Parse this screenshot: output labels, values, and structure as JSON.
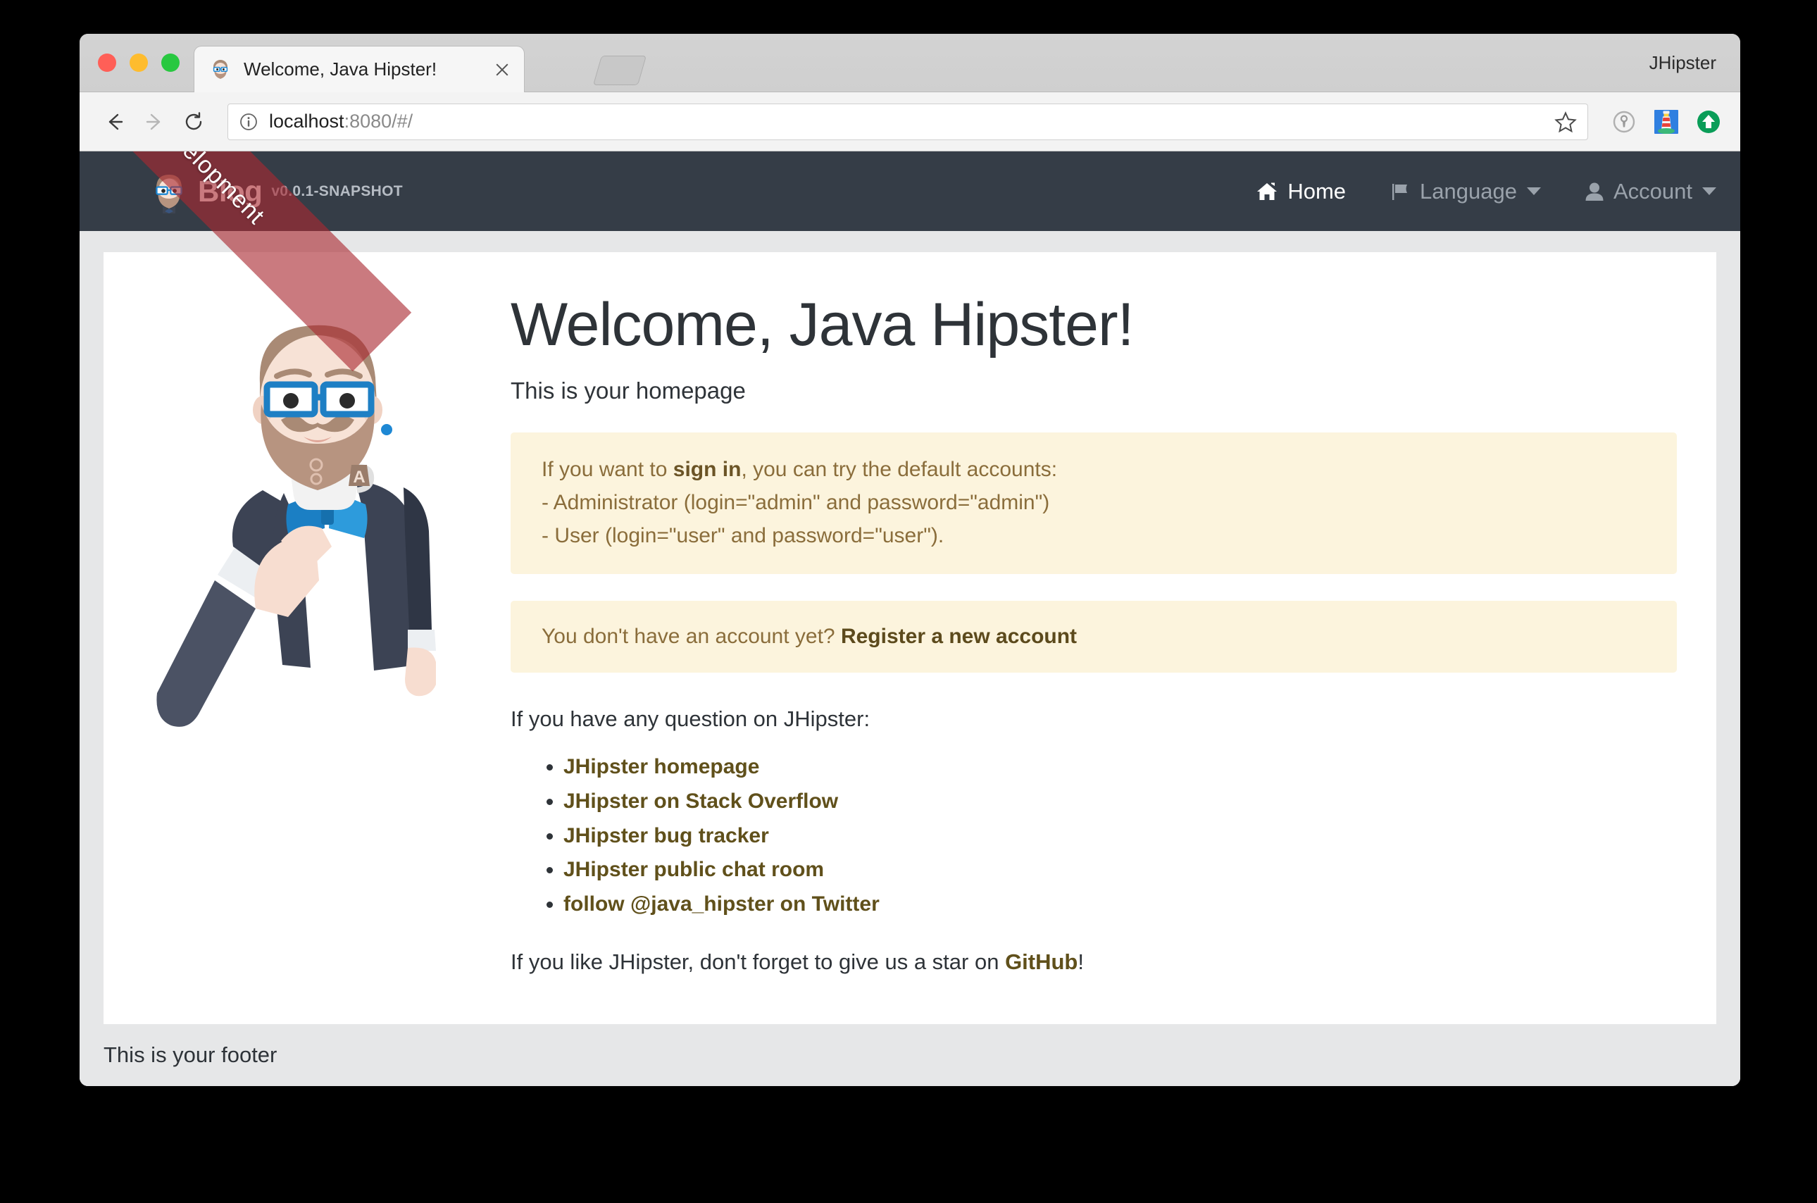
{
  "browser": {
    "profile_name": "JHipster",
    "tab": {
      "title": "Welcome, Java Hipster!",
      "favicon": "hipster-face-icon",
      "close_icon": "close-icon"
    },
    "new_tab_icon": "new-tab-icon",
    "toolbar": {
      "back_icon": "back-arrow-icon",
      "forward_icon": "forward-arrow-icon",
      "reload_icon": "reload-icon",
      "info_icon": "info-circle-icon",
      "url_host": "localhost",
      "url_rest": ":8080/#/",
      "url_full": "localhost:8080/#/",
      "bookmark_icon": "star-icon",
      "extensions": [
        {
          "name": "keyhole-icon"
        },
        {
          "name": "lighthouse-icon"
        },
        {
          "name": "green-up-arrow-icon"
        }
      ]
    },
    "traffic_lights": [
      {
        "name": "close-window-button",
        "color": "#ff5f57"
      },
      {
        "name": "minimize-window-button",
        "color": "#febc2e"
      },
      {
        "name": "maximize-window-button",
        "color": "#28c840"
      }
    ]
  },
  "app": {
    "ribbon": {
      "label": "Development",
      "color": "#aa2830"
    },
    "navbar": {
      "brand_logo": "hipster-avatar-icon",
      "brand_title": "Blog",
      "version": "v0.0.1-SNAPSHOT",
      "background": "#353d47",
      "items": [
        {
          "label": "Home",
          "icon": "home-icon",
          "active": true,
          "has_caret": false
        },
        {
          "label": "Language",
          "icon": "flag-icon",
          "active": false,
          "has_caret": true
        },
        {
          "label": "Account",
          "icon": "user-icon",
          "active": false,
          "has_caret": true
        }
      ]
    },
    "home": {
      "title": "Welcome, Java Hipster!",
      "subtitle": "This is your homepage",
      "signin_alert": {
        "intro_before": "If you want to ",
        "intro_link": "sign in",
        "intro_after": ", you can try the default accounts:",
        "line_admin": "- Administrator (login=\"admin\" and password=\"admin\")",
        "line_user": "- User (login=\"user\" and password=\"user\").",
        "background": "#fcf4dd",
        "text_color": "#8a6d3b"
      },
      "register_alert": {
        "text": "You don't have an account yet? ",
        "link": "Register a new account"
      },
      "question_line": "If you have any question on JHipster:",
      "links": [
        "JHipster homepage",
        "JHipster on Stack Overflow",
        "JHipster bug tracker",
        "JHipster public chat room",
        "follow @java_hipster on Twitter"
      ],
      "github_before": "If you like JHipster, don't forget to give us a star on ",
      "github_link": "GitHub",
      "github_after": "!",
      "link_color": "#60501b"
    },
    "footer": {
      "text": "This is your footer"
    }
  }
}
